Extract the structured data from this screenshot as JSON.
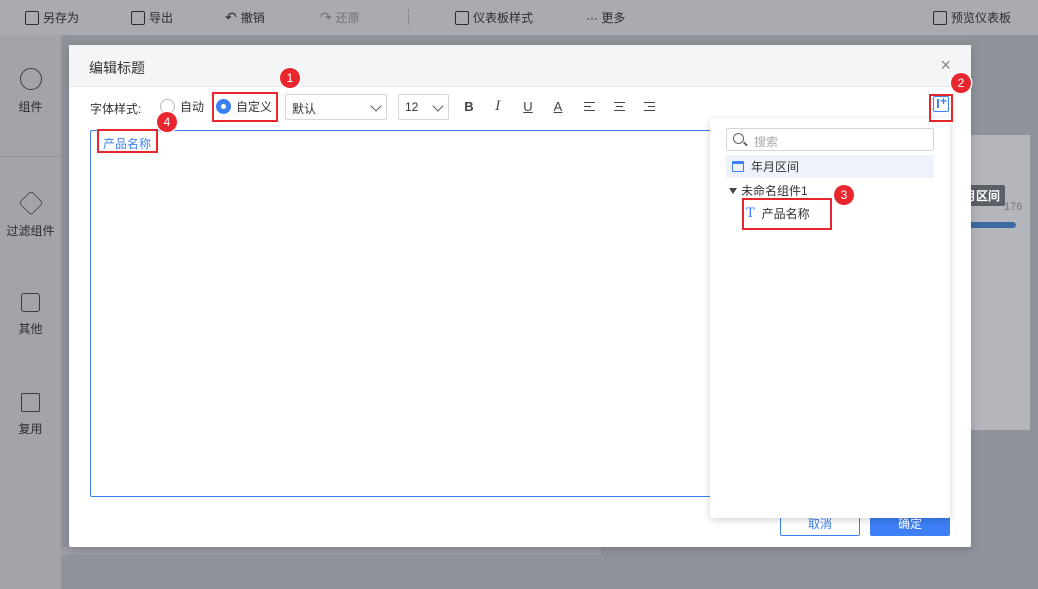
{
  "toolbar": {
    "save_as": "另存为",
    "export": "导出",
    "undo": "撤销",
    "redo": "还原",
    "dashboard_style": "仪表板样式",
    "more": "··· 更多",
    "preview": "预览仪表板"
  },
  "sidebar": {
    "items": [
      {
        "label": "组件",
        "icon": "plus-circle-icon"
      },
      {
        "label": "过滤组件",
        "icon": "cube-icon"
      },
      {
        "label": "其他",
        "icon": "list-icon"
      },
      {
        "label": "复用",
        "icon": "copy-icon"
      }
    ]
  },
  "background": {
    "tooltip": "年月区间",
    "number": "176"
  },
  "dialog": {
    "title": "编辑标题",
    "close": "×",
    "font_style_label": "字体样式:",
    "radio_auto": "自动",
    "radio_custom": "自定义",
    "font_family": "默认",
    "font_size": "12",
    "bold": "B",
    "italic": "I",
    "underline": "U",
    "color": "A",
    "editor_text": "产品名称",
    "cancel": "取消",
    "ok": "确定"
  },
  "field_panel": {
    "search_placeholder": "搜索",
    "items": [
      {
        "label": "年月区间",
        "icon": "calendar-icon"
      },
      {
        "label": "未命名组件1",
        "icon": "triangle-down-icon"
      },
      {
        "label": "产品名称",
        "icon": "text-t-icon"
      }
    ]
  },
  "annotations": [
    "1",
    "2",
    "3",
    "4"
  ],
  "colors": {
    "accent": "#3d7ff5",
    "marker": "#e8262d"
  }
}
